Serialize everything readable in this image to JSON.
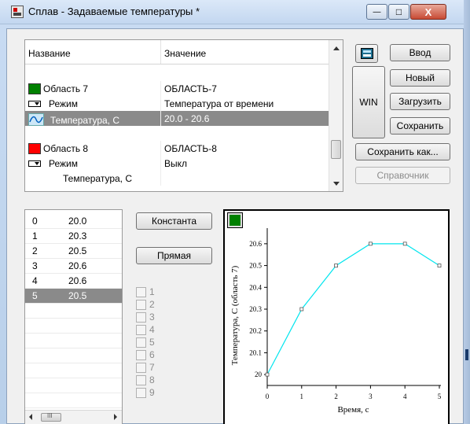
{
  "window": {
    "title": "Сплав - Задаваемые температуры *",
    "controls": {
      "minimize": "—",
      "maximize": "□",
      "close": "X"
    }
  },
  "property_list": {
    "columns": [
      "Название",
      "Значение"
    ],
    "rows": [
      {
        "name": "Область 7",
        "value": "ОБЛАСТЬ-7",
        "swatch_color": "#008000"
      },
      {
        "name": "Режим",
        "value": "Температура от времени",
        "icon": "mode-icon"
      },
      {
        "name": "Температура, С",
        "value": "20.0 - 20.6",
        "icon": "wave-icon",
        "selected": true
      },
      {
        "name": "Область 8",
        "value": "ОБЛАСТЬ-8",
        "swatch_color": "#ff0000"
      },
      {
        "name": "Режим",
        "value": "Выкл",
        "icon": "mode-icon"
      },
      {
        "name": "Температура, С",
        "value": ""
      }
    ]
  },
  "buttons": {
    "input": "Ввод",
    "new": "Новый",
    "win": "WIN",
    "load": "Загрузить",
    "save": "Сохранить",
    "save_as": "Сохранить как...",
    "reference": "Справочник",
    "constant": "Константа",
    "line": "Прямая"
  },
  "data_table": {
    "rows": [
      {
        "index": "0",
        "value": "20.0"
      },
      {
        "index": "1",
        "value": "20.3"
      },
      {
        "index": "2",
        "value": "20.5"
      },
      {
        "index": "3",
        "value": "20.6"
      },
      {
        "index": "4",
        "value": "20.6"
      },
      {
        "index": "5",
        "value": "20.5",
        "selected": true
      }
    ],
    "hscroll_grip": "III"
  },
  "checkboxes": [
    "1",
    "2",
    "3",
    "4",
    "5",
    "6",
    "7",
    "8",
    "9"
  ],
  "chart_data": {
    "type": "line",
    "x": [
      0,
      1,
      2,
      3,
      4,
      5
    ],
    "series": [
      {
        "values": [
          20.0,
          20.3,
          20.5,
          20.6,
          20.6,
          20.5
        ],
        "color": "#00e5ee"
      }
    ],
    "xlabel": "Время, с",
    "ylabel": "Температура, С (область 7)",
    "xlim": [
      0,
      5
    ],
    "ylim": [
      19.95,
      20.65
    ],
    "xticks": [
      "0",
      "1",
      "2",
      "3",
      "4",
      "5"
    ],
    "yticks": [
      "20",
      "20.1",
      "20.2",
      "20.3",
      "20.4",
      "20.5",
      "20.6"
    ],
    "legend_swatch_color": "#008000",
    "grid": false
  }
}
